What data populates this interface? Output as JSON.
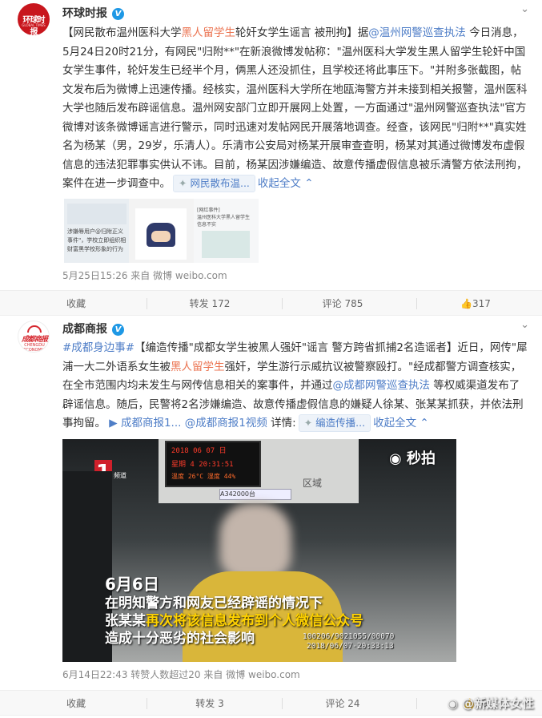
{
  "post1": {
    "author": "环球时报",
    "avatar_text": "环球时报",
    "avatar_sub": "GLOBAL TIMES",
    "text_a": "【网民散布温州医科大学",
    "highlight": "黑人留学生",
    "text_b": "轮奸女学生谣言 被刑拘】据",
    "mention": "@温州网警巡查执法",
    "text_c": " 今日消息，5月24日20时21分，有网民\"归附**\"在新浪微博发帖称：\"温州医科大学发生黑人留学生轮奸中国女学生事件，轮奸发生已经半个月，俩黑人还没抓住，且学校还将此事压下。\"并附多张截图，帖文发布后为微博上迅速传播。经核实，温州医科大学所在地瓯海警方并未接到相关报警，温州医科大学也随后发布辟谣信息。温州网安部门立即开展网上处置，一方面通过\"温州网警巡查执法\"官方微博对该条微博谣言进行警示，同时迅速对发帖网民开展落地调查。经查，该网民\"归附**\"真实姓名为杨某（男，29岁，乐清人）。乐清市公安局对杨某开展审查查明，杨某对其通过微博发布虚假信息的违法犯罪事实供认不讳。目前，杨某因涉嫌编造、故意传播虚假信息被乐清警方依法刑拘，案件在进一步调查中。",
    "chip_label": "网民散布温...",
    "collapse": "收起全文",
    "thumb1_text": "涉嫌辱用户@归附正义\n事件\"，学校立即组织相\n财富黑学校形象的行为",
    "thumb2_text": "[网红事件]\n温州医科大学黑人留学生\n信息不实",
    "meta": "5月25日15:26 来自 微博 weibo.com",
    "actions": {
      "fav": "收藏",
      "repost": "转发 172",
      "comment": "评论 785",
      "like": "317"
    }
  },
  "post2": {
    "author": "成都商报",
    "avatar_text": "成都商报",
    "avatar_sub": "CHENGDU ECONOMIC DAILY",
    "hashtag": "#成都身边事#",
    "text_a": "【编造传播\"成都女学生被黑人强奸\"谣言 警方跨省抓捕2名造谣者】近日，网传\"犀浦一大二外语系女生被",
    "highlight": "黑人留学生",
    "text_b": "强奸，学生游行示威抗议被警察殴打。\"经成都警方调查核实，在全市范围内均未发生与网传信息相关的案事件，并通过",
    "mention": "@成都网警巡查执法",
    "text_c": " 等权威渠道发布了辟谣信息。随后，民警将2名涉嫌编造、故意传播虚假信息的嫌疑人徐某、张某某抓获，并依法刑事拘留。",
    "link1": "成都商报1...",
    "link2": "@成都商报1视频",
    "details": "详情:",
    "chip_label": "编造传播...",
    "collapse": "收起全文",
    "video": {
      "clock_date": "2018 06 07 日",
      "clock_time": "星期 4 20:31:51",
      "clock_temp": "温度 26°C 湿度 44%",
      "channel_logo": "1",
      "channel_sub": "频道",
      "brand": "秒拍",
      "area_sign": "区域",
      "room_code": "A342000台",
      "caption_date": "6月6日",
      "caption_line1": "在明知警方和网友已经辟谣的情况下",
      "caption_line2_a": "张某某",
      "caption_line2_b": "再次将该信息发布到个人微信公众号",
      "caption_line3": "造成十分恶劣的社会影响",
      "stamp1": "100206/9021055/00070",
      "stamp2": "2018/06/07-20:33:13"
    },
    "meta": "6月14日22:43 转赞人数超过20 来自 微博 weibo.com",
    "actions": {
      "fav": "收藏",
      "repost": "转发 3",
      "comment": "评论 24",
      "like": "26"
    }
  },
  "watermark": "@新媒体女性",
  "colors": {
    "accent_orange": "#eb7350",
    "link_blue": "#4f7ec7",
    "verified_blue": "#1e98e5"
  }
}
